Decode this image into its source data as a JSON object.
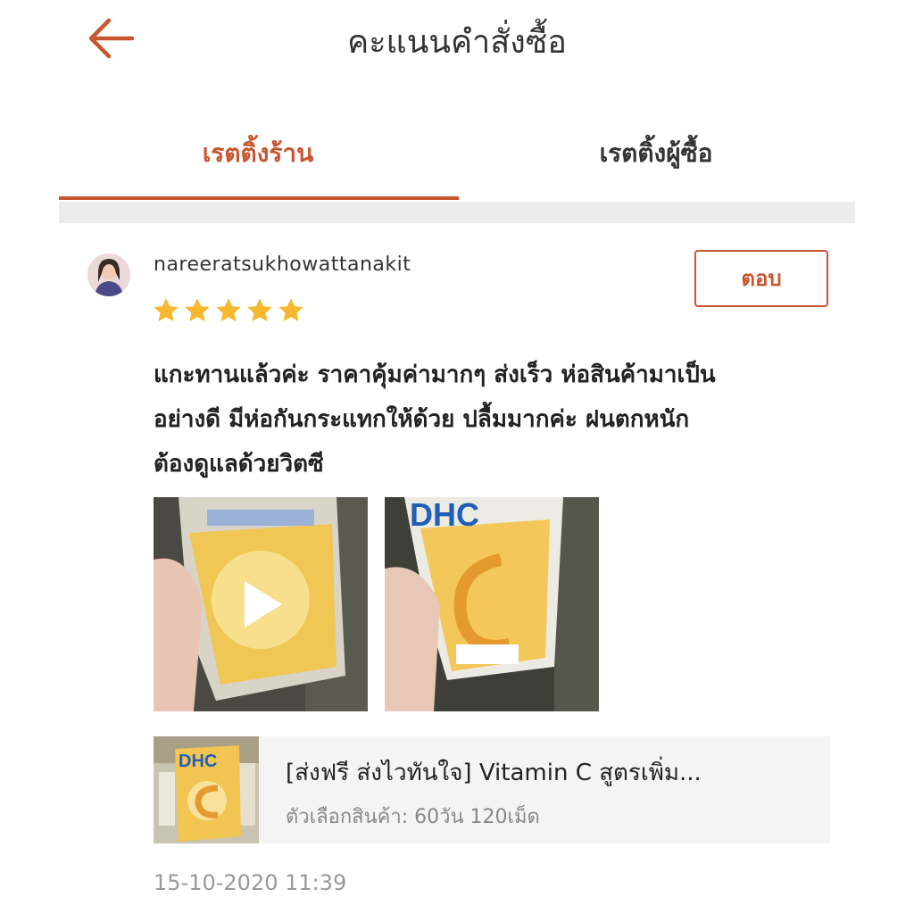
{
  "colors": {
    "accent": "#c9552f",
    "star": "#f5b82e",
    "muted_text": "#999999"
  },
  "header": {
    "title": "คะแนนคำสั่งซื้อ",
    "back_icon": "arrow-left-icon"
  },
  "tabs": [
    {
      "label": "เรตติ้งร้าน",
      "active": true
    },
    {
      "label": "เรตติ้งผู้ซื้อ",
      "active": false
    }
  ],
  "review": {
    "username": "nareeratsukhowattanakit",
    "rating": 5,
    "rating_max": 5,
    "reply_label": "ตอบ",
    "text_lines": [
      "แกะทานแล้วค่ะ ราคาคุ้มค่ามากๆ ส่งเร็ว ห่อสินค้ามาเป็น",
      "อย่างดี มีห่อกันกระแทกให้ด้วย ปลื้มมากค่ะ ฝนตกหนัก",
      "ต้องดูแลด้วยวิตซี"
    ],
    "media": [
      {
        "type": "video",
        "icon": "play-icon"
      },
      {
        "type": "image"
      }
    ],
    "product": {
      "name": "[ส่งฟรี ส่งไวทันใจ] Vitamin C สูตรเพิ่ม...",
      "variant": "ตัวเลือกสินค้า: 60วัน 120เม็ด"
    },
    "timestamp": "15-10-2020 11:39"
  }
}
